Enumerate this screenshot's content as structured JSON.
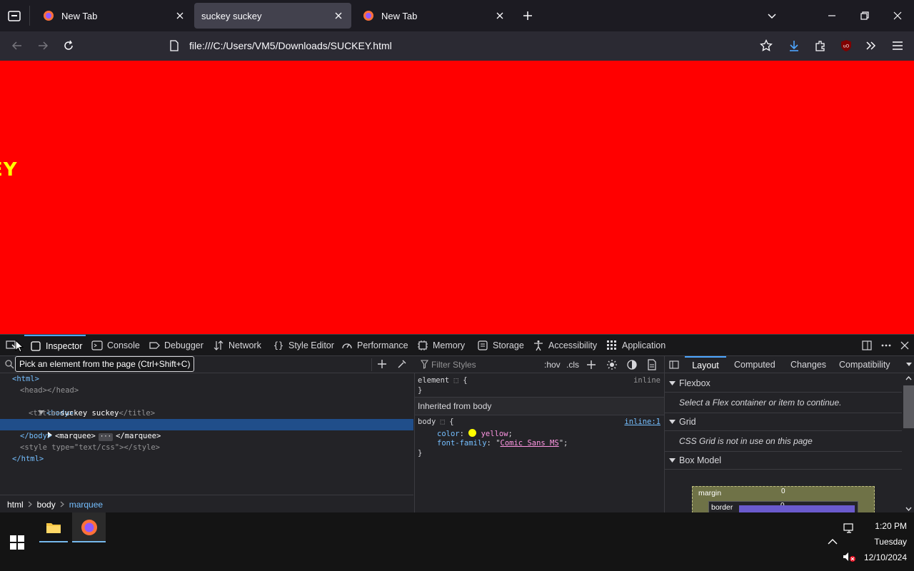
{
  "browser": {
    "tabs": [
      {
        "title": "New Tab",
        "active": false
      },
      {
        "title": "suckey suckey",
        "active": true
      },
      {
        "title": "New Tab",
        "active": false
      }
    ],
    "url": "file:///C:/Users/VM5/Downloads/SUCKEY.html"
  },
  "page": {
    "marquee_visible_text": "EY",
    "background": "#ff0000",
    "text_color": "#ffff00"
  },
  "devtools": {
    "tabs": [
      "Inspector",
      "Console",
      "Debugger",
      "Network",
      "Style Editor",
      "Performance",
      "Memory",
      "Storage",
      "Accessibility",
      "Application"
    ],
    "tooltip": "Pick an element from the page (Ctrl+Shift+C)",
    "filter_styles_placeholder": "Filter Styles",
    "hov": ":hov",
    "cls": ".cls",
    "markup": {
      "html_open": "<html>",
      "head": "<head></head>",
      "body_open": "<body>",
      "title_open": "<title>",
      "title_text": "suckey suckey",
      "title_close": "</title>",
      "marquee_open": "<marquee>",
      "marquee_close": "</marquee>",
      "body_close": "</body>",
      "style_line_open": "<style ",
      "style_attr": "type",
      "style_val": "\"text/css\"",
      "style_line_close": "></style>",
      "html_close": "</html>"
    },
    "breadcrumb": [
      "html",
      "body",
      "marquee"
    ],
    "rules": {
      "element_selector": "element",
      "element_source": "inline",
      "inherited_header": "Inherited from body",
      "body_selector": "body",
      "body_source": "inline:1",
      "prop1_name": "color",
      "prop1_value": "yellow",
      "prop2_name": "font-family",
      "prop2_value": "Comic Sans MS",
      "brace_open": "{",
      "brace_close": "}"
    },
    "layout_tabs": [
      "Layout",
      "Computed",
      "Changes",
      "Compatibility"
    ],
    "layout": {
      "flexbox_header": "Flexbox",
      "flexbox_msg": "Select a Flex container or item to continue.",
      "grid_header": "Grid",
      "grid_msg": "CSS Grid is not in use on this page",
      "boxmodel_header": "Box Model",
      "margin_label": "margin",
      "margin_val": "0",
      "border_label": "border",
      "border_val": "0"
    }
  },
  "taskbar": {
    "time": "1:20 PM",
    "day": "Tuesday",
    "date": "12/10/2024"
  }
}
